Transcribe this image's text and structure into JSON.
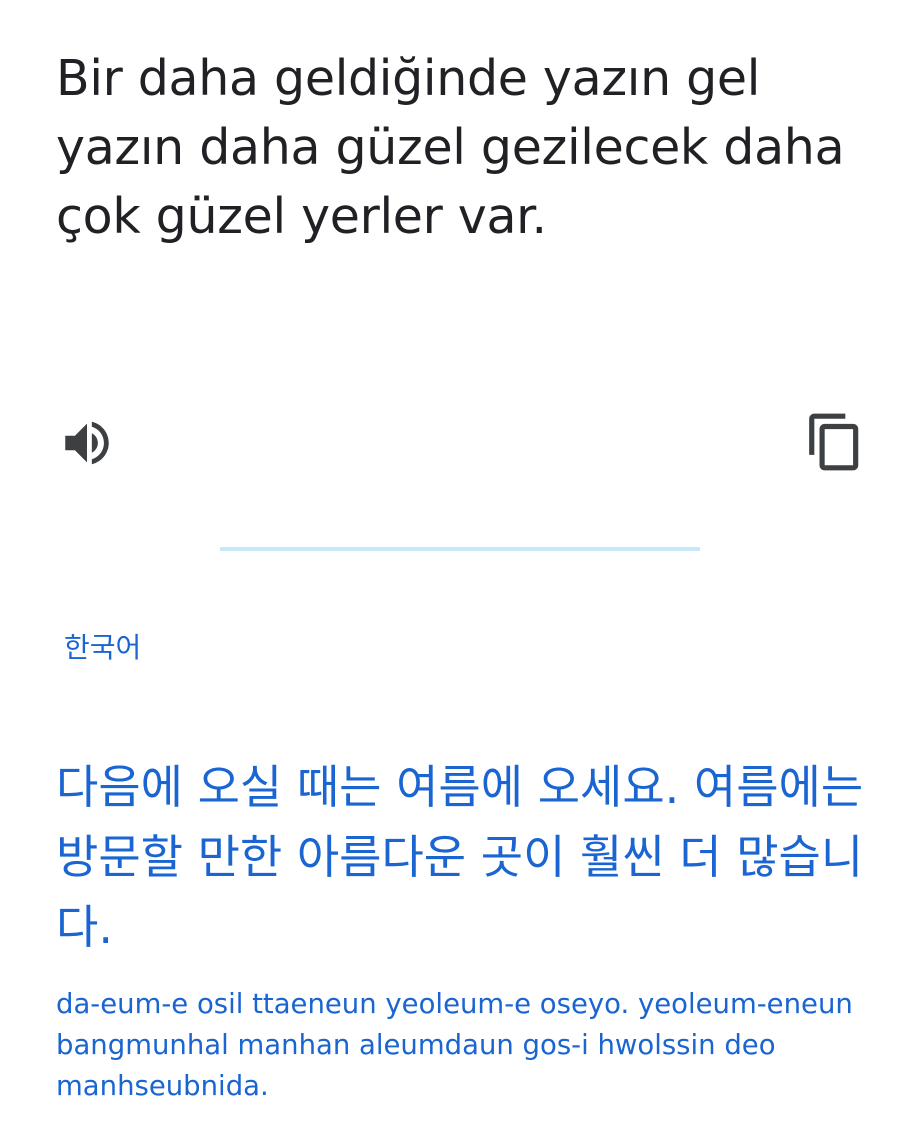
{
  "source": {
    "text": "Bir daha geldiğinde yazın gel yazın daha güzel gezilecek daha çok güzel yerler var."
  },
  "actions": {
    "speak_icon": "speaker-volume-icon",
    "copy_icon": "copy-icon"
  },
  "target": {
    "language": "한국어",
    "text": "다음에 오실 때는 여름에 오세요. 여름에는 방문할 만한 아름다운 곳이 훨씬 더 많습니다.",
    "romanization": "da-eum-e osil ttaeneun yeoleum-e oseyo. yeoleum-eneun bangmunhal manhan aleumdaun gos-i hwolssin deo manhseubnida."
  },
  "colors": {
    "source_text": "#202124",
    "accent_blue": "#1a65d1",
    "divider": "#c9e7fb",
    "icon": "#3c4043"
  }
}
